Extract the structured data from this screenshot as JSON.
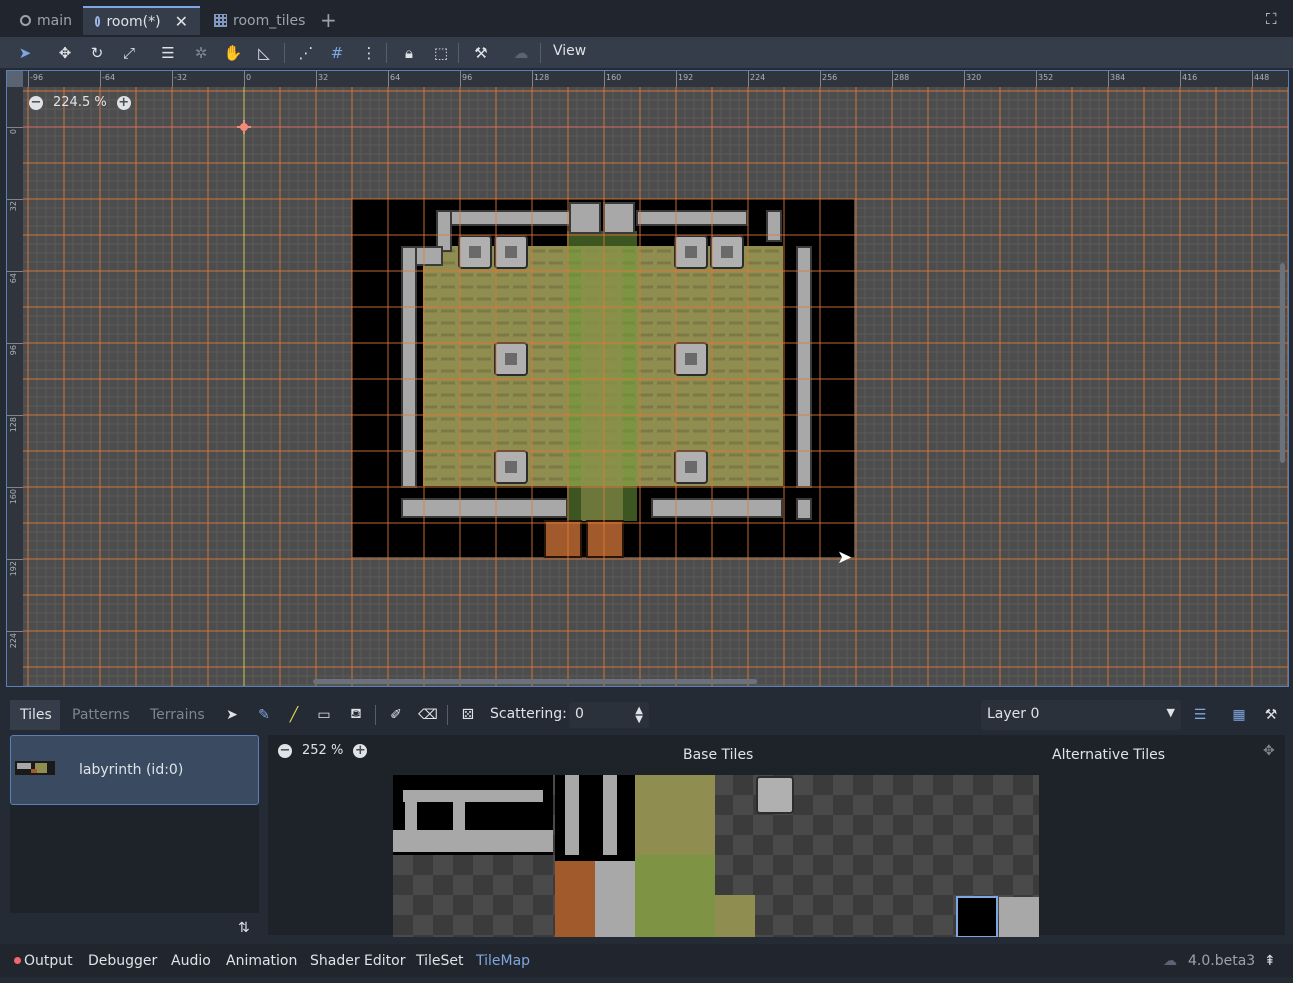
{
  "tabs": [
    {
      "label": "main",
      "icon": "scene-icon"
    },
    {
      "label": "room(*)",
      "icon": "scene-icon",
      "active": true
    },
    {
      "label": "room_tiles",
      "icon": "tileset-icon"
    }
  ],
  "toolbar": {
    "view_label": "View"
  },
  "viewport": {
    "zoom": "224.5 %",
    "hruler_ticks": [
      "-96",
      "-64",
      "-32",
      "0",
      "32",
      "64",
      "96",
      "128",
      "160",
      "192",
      "224",
      "256",
      "288",
      "320",
      "352",
      "384",
      "416",
      "448"
    ],
    "vruler_ticks": [
      "0",
      "32",
      "64",
      "96",
      "128",
      "160",
      "192",
      "224"
    ]
  },
  "tilemap_panel": {
    "tabs": [
      "Tiles",
      "Patterns",
      "Terrains"
    ],
    "scattering_label": "Scattering:",
    "scattering_value": "0",
    "layer_select": "Layer 0",
    "source_item": "labyrinth (id:0)",
    "atlas_zoom": "252 %",
    "base_tiles_label": "Base Tiles",
    "alt_tiles_label": "Alternative Tiles"
  },
  "statusbar": {
    "items": [
      "Output",
      "Debugger",
      "Audio",
      "Animation",
      "Shader Editor",
      "TileSet",
      "TileMap"
    ],
    "version": "4.0.beta3"
  },
  "colors": {
    "accent": "#7ea6e0",
    "grid_orange": "#e07a3a",
    "floor": "#8f8d4f",
    "wall": "#a8a8a8",
    "dark_bg": "#252b34"
  }
}
